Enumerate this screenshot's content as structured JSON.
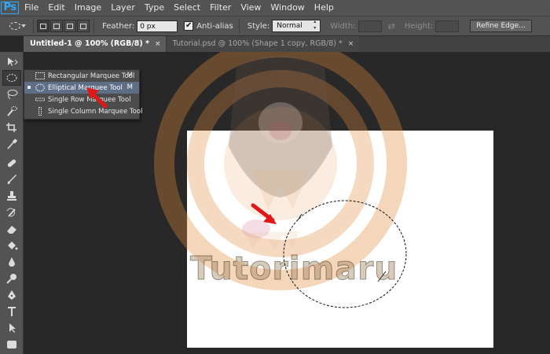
{
  "app": {
    "logo": "Ps"
  },
  "menubar": {
    "items": [
      "File",
      "Edit",
      "Image",
      "Layer",
      "Type",
      "Select",
      "Filter",
      "View",
      "Window",
      "Help"
    ]
  },
  "options": {
    "feather_label": "Feather:",
    "feather_value": "0 px",
    "antialias_label": "Anti-alias",
    "antialias_checked": "✔",
    "style_label": "Style:",
    "style_value": "Normal",
    "width_label": "Width:",
    "height_label": "Height:",
    "swap_icon": "⇄",
    "refine_edge_label": "Refine Edge..."
  },
  "tabs": [
    {
      "label": "Untitled-1 @ 100% (RGB/8) *",
      "close": "×"
    },
    {
      "label": "Tutorial.psd @ 100% (Shape 1 copy, RGB/8) *",
      "close": "×"
    }
  ],
  "flyout": {
    "items": [
      {
        "label": "Rectangular Marquee Tool",
        "shortcut": "M",
        "icon": "rect-marquee-icon"
      },
      {
        "label": "Elliptical Marquee Tool",
        "shortcut": "M",
        "icon": "ellipse-marquee-icon"
      },
      {
        "label": "Single Row Marquee Tool",
        "shortcut": "",
        "icon": "row-marquee-icon"
      },
      {
        "label": "Single Column Marquee Tool",
        "shortcut": "",
        "icon": "column-marquee-icon"
      }
    ]
  },
  "watermark": {
    "text": "Tutorimaru"
  },
  "colors": {
    "menubar": "#535353",
    "workspace": "#282828",
    "canvas": "#ffffff",
    "highlight": "#5f6e87",
    "annotation_arrow": "#e01818",
    "watermark_ring": "#e08a3c"
  }
}
